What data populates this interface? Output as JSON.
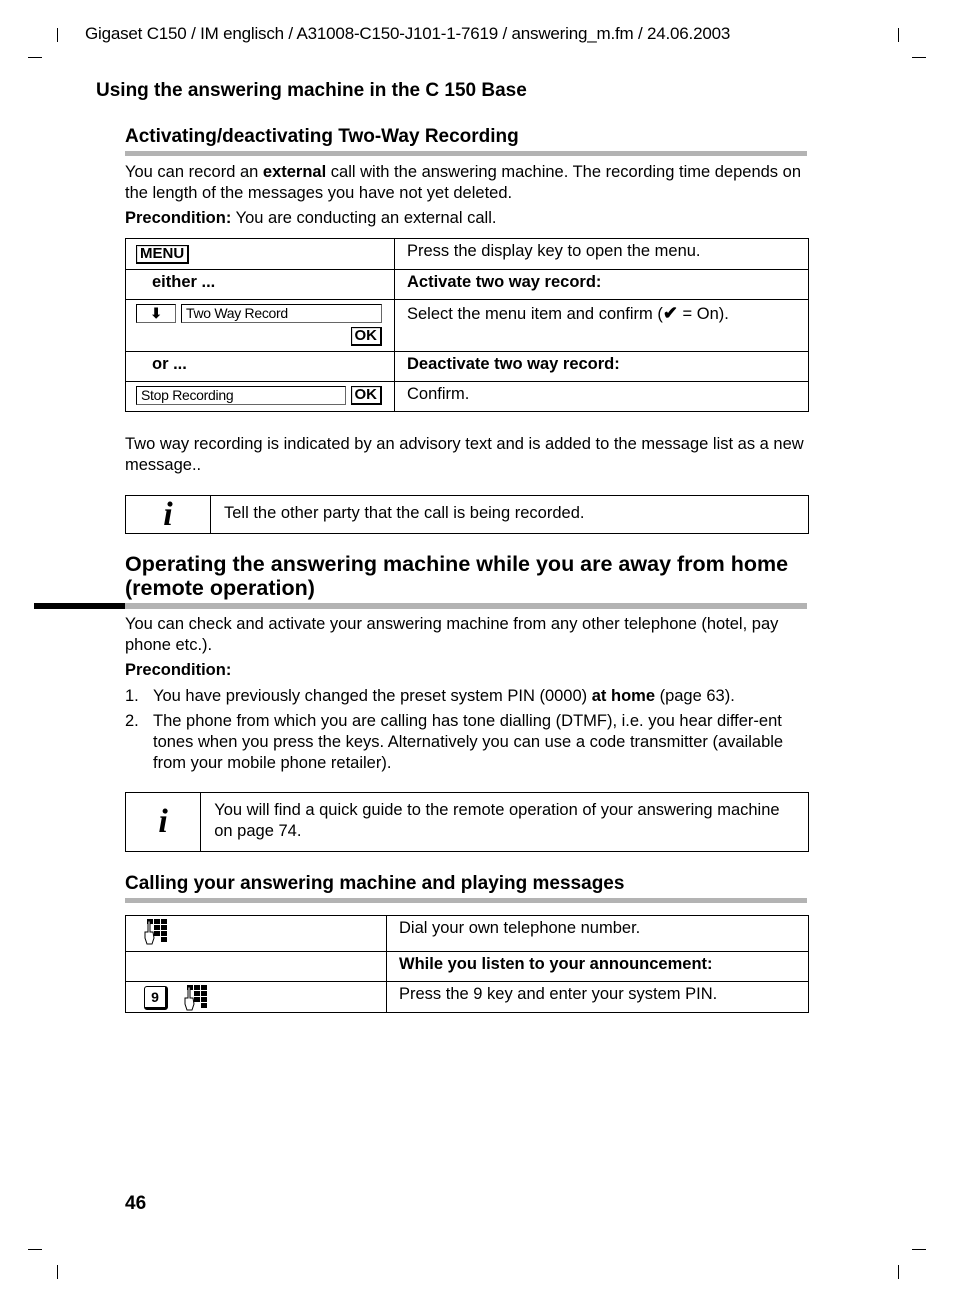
{
  "header": {
    "doc_info": "Gigaset C150 / IM englisch / A31008-C150-J101-1-7619 / answering_m.fm / 24.06.2003",
    "running_title": "Using the answering machine in the C 150 Base"
  },
  "section1": {
    "heading": "Activating/deactivating Two-Way Recording",
    "intro_pre": "You can record an ",
    "intro_bold": "external",
    "intro_post": " call with the answering machine. The recording time depends on the length of the messages you have not yet deleted.",
    "precondition_label": "Precondition:",
    "precondition_text": " You are conducting an external call.",
    "steps": {
      "menu_key": "MENU",
      "row1_text": "Press the display key to open the menu.",
      "either_label": "either ...",
      "activate_heading": "Activate two way record:",
      "arrow_icon": "arrow-down-icon",
      "two_way_display": "Two Way Record",
      "ok_key": "OK",
      "select_text_pre": "Select the menu item and confirm (",
      "check_icon": "checkmark-icon",
      "select_text_post": " = On).",
      "or_label": "or ...",
      "deactivate_heading": "Deactivate two way record:",
      "stop_display": "Stop Recording",
      "confirm_text": "Confirm."
    },
    "note_text": "Two way recording is indicated by an advisory text and is added to the message list as a new message..",
    "info_icon": "info-icon",
    "info_text": "Tell the other party that the call is being recorded."
  },
  "section2": {
    "heading": "Operating the answering machine while you are away from home (remote operation)",
    "intro": "You can check and activate your answering machine from any other telephone (hotel, pay phone etc.).",
    "precondition_label": "Precondition:",
    "items": [
      {
        "num": "1.",
        "pre": "You have previously changed the preset system PIN (0000) ",
        "bold": "at home",
        "post": " (page 63)."
      },
      {
        "num": "2.",
        "pre": "The phone from which you are calling has tone dialling (DTMF), i.e. you hear differ-ent tones when you press the keys. Alternatively you can use a code transmitter (available from your mobile phone retailer).",
        "bold": "",
        "post": ""
      }
    ],
    "info_text": "You will find a quick guide to the remote operation of your answering machine on page 74."
  },
  "section3": {
    "heading": "Calling your answering machine and playing messages",
    "keypad_icon": "keypad-icon",
    "row1_text": "Dial your own telephone number.",
    "row2_heading": "While you listen to your announcement:",
    "key_9": "9",
    "row3_text": "Press the 9 key and enter your system PIN."
  },
  "footer": {
    "page_number": "46"
  }
}
